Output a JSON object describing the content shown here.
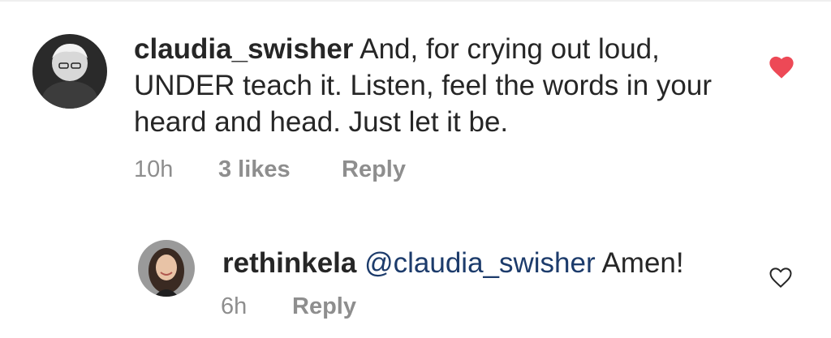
{
  "comments": [
    {
      "username": "claudia_swisher",
      "text": "And, for crying out loud, UNDER teach it. Listen, feel the words in your heard and head. Just let it be.",
      "time": "10h",
      "likes": "3 likes",
      "reply_label": "Reply",
      "liked": true,
      "heart_color": "#ed4956"
    },
    {
      "username": "rethinkela",
      "mention": "@claudia_swisher",
      "text": "Amen!",
      "time": "6h",
      "reply_label": "Reply",
      "liked": false
    }
  ],
  "colors": {
    "text": "#262626",
    "meta": "#8e8e8e",
    "mention": "#1c3b6b",
    "heart_liked": "#ed4956"
  }
}
